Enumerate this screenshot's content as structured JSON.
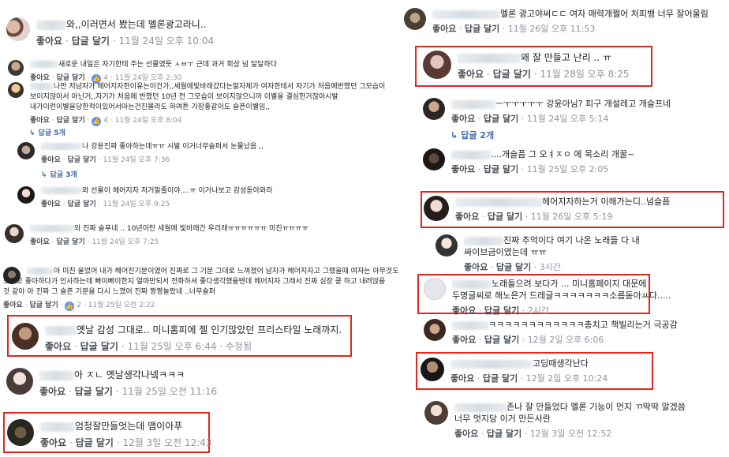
{
  "action_labels": {
    "like": "좋아요",
    "reply": "답글 달기",
    "dot": "·"
  },
  "comments": [
    {
      "text": "와,,이러면서 봤는데 멜론광고라니..",
      "time": "11월 24일 오후 10:04"
    },
    {
      "text": "새로운 내일은 자기한테 주는 선물였듯 ㅅㅂㅜ 근데 과거 회상 넘 달달하다",
      "time": "11월 24일 오후 2:30",
      "likes": "4"
    },
    {
      "lines": [
        "나만 저남자가 헤어지자한이유는이건가,,세월에빛바래갔다는말자체가 여자한테서 자기가 처음에반했던 그모습이",
        "보이지않아서 아닌거,,자기가 처음에 반했던 10년 전 그모습이 보이지않으니까 이별을 결심한거잖아시발",
        "내가이런이별을당한적이있어서아는건진몰라도 하여튼 가장좋같이도 슬픈이별임,,"
      ],
      "time": "11월 24일 오후 8:04",
      "likes": "4",
      "replies": "답글 5개"
    },
    {
      "text": "나 강윤진짜 좋아하는데ㅠㅠ 시발 이거너무슬퍼서 눈물났음 ,,",
      "time": "11월 24일 오후 7:36",
      "replies": "답글 3개"
    },
    {
      "text": "와 선물이 헤어지자 저거말줄이야.…ㅠ 이거나보고 감성돋아와라",
      "time": "11월 24일 오후 9:25"
    },
    {
      "text": "와 진짜 슬푸네 .. 10년이란 세월에 빛바래간 우리래ㅠㅠㅠㅠㅠㅠ 미친ㅠㅠㅠㅠ",
      "time": "11월 24일 오후 7:25"
    },
    {
      "lines": [
        "아 미친 울었어 내가 헤어진기분이였어 진짜로 그 기분 그대로 느껴졌어 남자가 헤어지자고 그랬을때 여자는 아무것도",
        "모르고 좋아하다가 인사하는데 빠이빠이한지 얼마만되서 전화하셔 좋다생각했을텐데 헤어지자 그래서 진짜 심장 쿵 하고 내려앉을",
        "것 같아 아 진짜 그 슬픈 기분을 다시 느꼈어 진짜 짱짱놀랐네 ..너무슬퍼"
      ],
      "time": "11월 25일 오전 2:22",
      "likes": "2"
    },
    {
      "text": "옛날 감성 그대로.. 미니홈피에 젤 인기많았던 프리스타일 노래까지.",
      "time": "11월 25일 오후 6:44",
      "edited": "수정됨"
    },
    {
      "text": "아 ㅈㄴ 옛날생각나넼ㅋㅋㅋ",
      "time": "11월 25일 오전 11:16"
    },
    {
      "text": "엄청잘만들엇는데 맴이아푸",
      "time": "12월 3일 오전 12:43"
    },
    {
      "text": "멜론 광고야써ㄷㄷ 여자 매력개쩔어 처피뱅 너무 잘어울림",
      "time": "11월 26일 오후 11:53"
    },
    {
      "text": "왜 잘 만들고 난리 .. ㅠ",
      "time": "11월 28일 오후 8:25"
    },
    {
      "text": "ㅡㅜㅜㅜㅜㅜ 강윤아님? 피구 개설레고 개슬프네",
      "time": "11월 24일 오후 5:14",
      "replies": "답글 2개"
    },
    {
      "text": "....개슬픔 그 오ㅕㅈㅇ 에 목소리 개꿀~",
      "time": "11월 25일 오후 2:05"
    },
    {
      "text": "헤어지자하는거 이해가는디..넘슬픔",
      "time": "11월 26일 오후 5:19"
    },
    {
      "lines": [
        "진짜 추억이다 여기 나온 노래들 다 내",
        "싸이브금이였는데 ㅠㅠ"
      ],
      "time": "3시간"
    },
    {
      "lines": [
        "노래들으려 보다가 ... 미니홈페이지 대문에",
        "두명글씨로 해노은거 드레글ㅋㅋㅋㅋㅋㅋㅋ소름돋아ㅛ다....."
      ],
      "time": "2시간"
    },
    {
      "text": "ㅋㅋㅋㅋㅋㅋㅋㅋㅋㅋㅋㅋ총치고 책빌리는거 극공감",
      "time": "12월 2일 오후 6:06"
    },
    {
      "text": "고딩때생각난다",
      "time": "12월 2일 오후 10:24"
    },
    {
      "lines": [
        "존나 잘 만들었다 멜론 기능이 먼지 ㄲ딱딱 알겠씀",
        "너무 멋지당 이거 만든사란"
      ],
      "time": "12월 3일 오전 12:52"
    }
  ],
  "colors": {
    "highlight": "#e0281c",
    "link": "#4267b2",
    "meta": "#90949c",
    "action": "#4b4f56"
  }
}
